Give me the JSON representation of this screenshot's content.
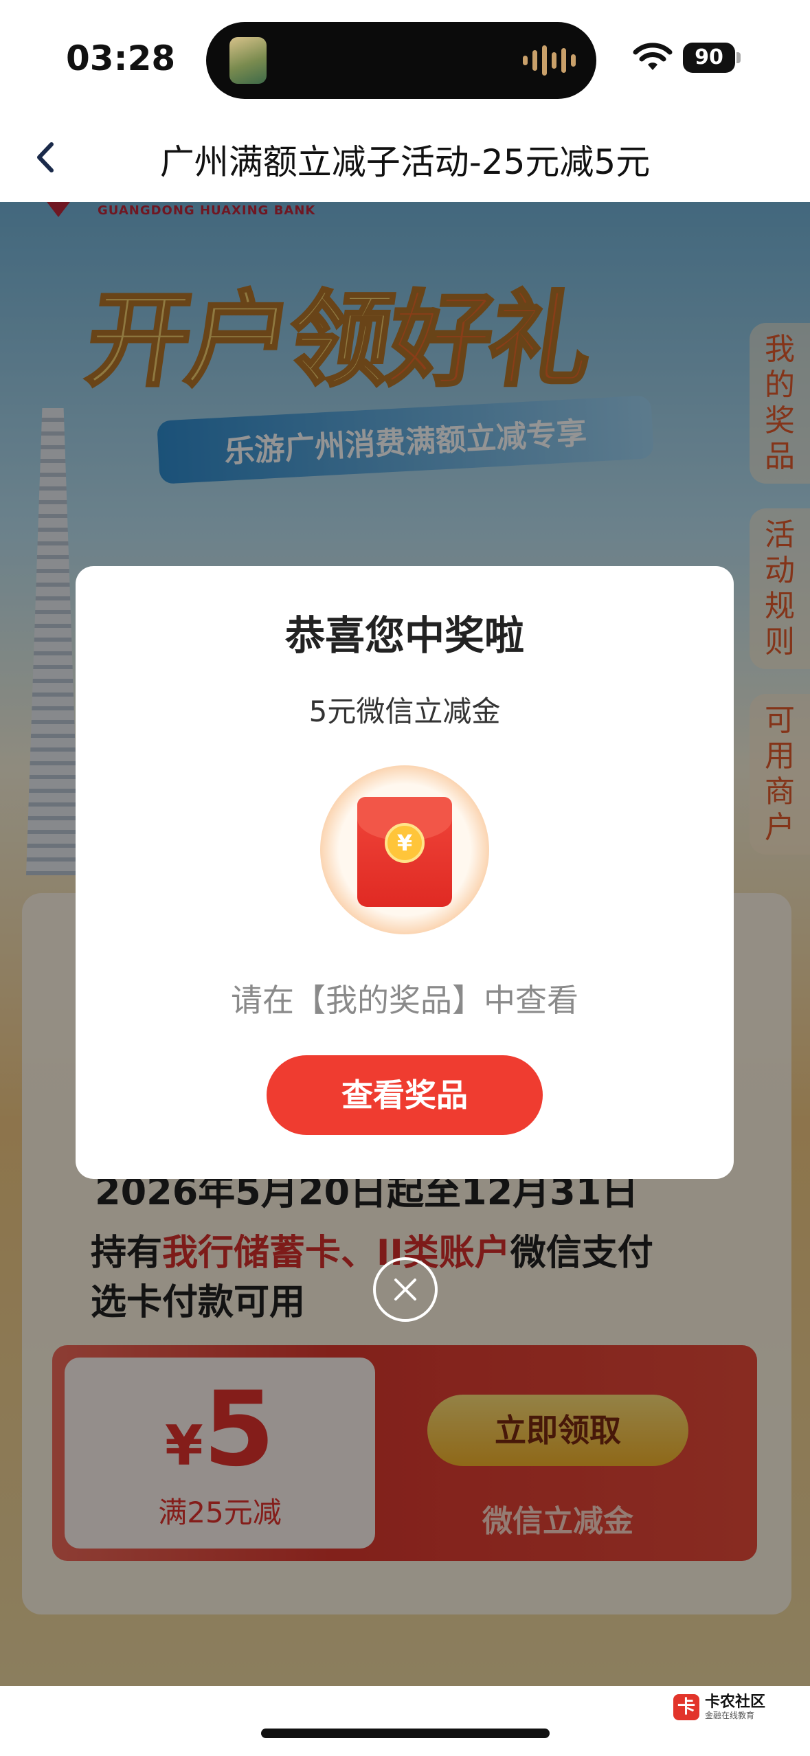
{
  "status_bar": {
    "time": "03:28",
    "battery": "90"
  },
  "nav": {
    "title": "广州满额立减子活动-25元减5元"
  },
  "banner": {
    "bank_name_en": "GUANGDONG HUAXING BANK",
    "headline_a": "开户领",
    "headline_b": "好礼",
    "ribbon": "乐游广州消费满额立减专享"
  },
  "side_tabs": [
    "我的奖品",
    "活动规则",
    "可用商户"
  ],
  "activity": {
    "date_text": "2026年5月20日起至12月31日",
    "hold_prefix": "持有",
    "hold_highlight": "我行储蓄卡、II类账户",
    "hold_suffix": "微信支付",
    "hold_line2": "选卡付款可用"
  },
  "coupon": {
    "currency": "¥",
    "amount": "5",
    "condition": "满25元减",
    "claim_label": "立即领取",
    "note": "微信立减金"
  },
  "modal": {
    "title": "恭喜您中奖啦",
    "prize": "5元微信立减金",
    "coin_symbol": "¥",
    "hint": "请在【我的奖品】中查看",
    "button": "查看奖品"
  },
  "watermark": {
    "logo": "卡",
    "name": "卡农社区",
    "sub": "金融在线教育"
  }
}
